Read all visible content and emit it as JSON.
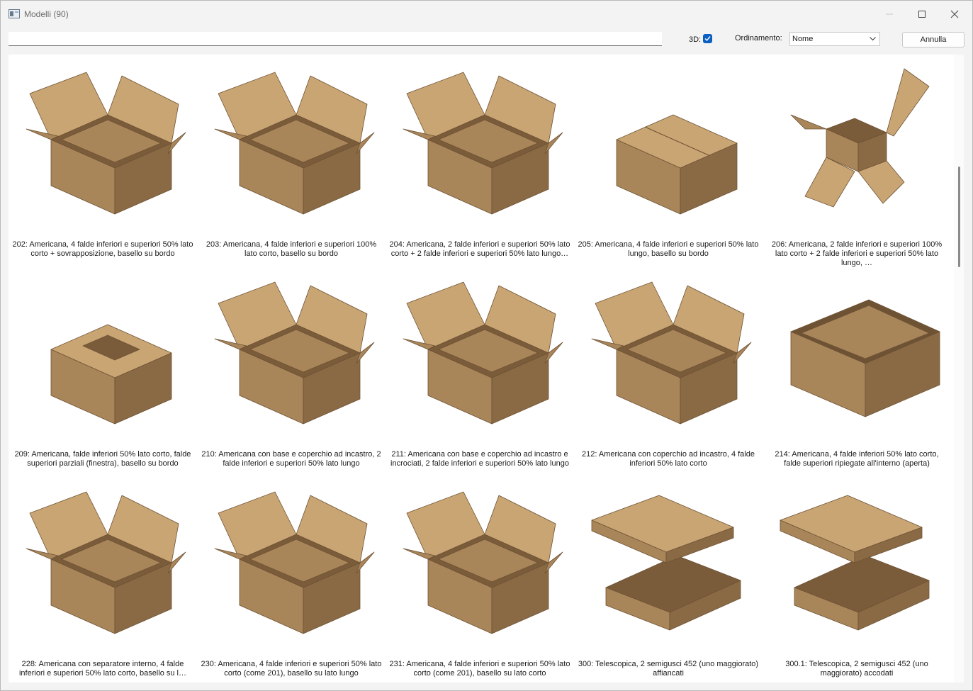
{
  "window": {
    "title": "Modelli (90)"
  },
  "toolbar": {
    "search_value": "",
    "label_3d": "3D:",
    "checkbox_3d_checked": true,
    "label_sort": "Ordinamento:",
    "sort_value": "Nome",
    "cancel_label": "Annulla"
  },
  "colors": {
    "accent": "#0a5fc2",
    "cardboard_light": "#c9a574",
    "cardboard_mid": "#a9855a",
    "cardboard_dark": "#8a6a45"
  },
  "models": [
    {
      "caption": "202: Americana, 4 falde inferiori e superiori 50% lato corto + sovrapposizione, basello su bordo",
      "icon": "box-open-4-flaps"
    },
    {
      "caption": "203: Americana, 4 falde inferiori e superiori 100% lato corto, basello su bordo",
      "icon": "box-open-long-flaps"
    },
    {
      "caption": "204: Americana, 2 falde inferiori e superiori 50% lato corto + 2 falde inferiori e superiori 50% lato lungo…",
      "icon": "box-open-4-flaps"
    },
    {
      "caption": "205: Americana, 4 falde inferiori e superiori 50% lato lungo, basello su bordo",
      "icon": "box-closed"
    },
    {
      "caption": "206: Americana, 2 falde inferiori e superiori 100% lato corto + 2 falde inferiori e superiori 50% lato lungo, …",
      "icon": "box-cross-flaps"
    },
    {
      "caption": "209: Americana, falde inferiori 50% lato corto, falde superiori parziali (finestra), basello su bordo",
      "icon": "box-window"
    },
    {
      "caption": "210: Americana con base e coperchio ad incastro, 2 falde inferiori e superiori 50% lato lungo",
      "icon": "box-interlock"
    },
    {
      "caption": "211: Americana con base e coperchio ad incastro e incrociati, 2 falde inferiori e superiori 50% lato lungo",
      "icon": "box-interlock"
    },
    {
      "caption": "212: Americana con coperchio ad incastro, 4 falde inferiori 50% lato corto",
      "icon": "box-interlock-open"
    },
    {
      "caption": "214: Americana, 4 falde inferiori 50% lato corto, falde superiori ripiegate all'interno (aperta)",
      "icon": "box-tray"
    },
    {
      "caption": "228: Americana con separatore interno, 4 falde inferiori e superiori 50% lato corto, basello su l…",
      "icon": "box-separator"
    },
    {
      "caption": "230: Americana, 4 falde inferiori e superiori 50% lato corto (come 201), basello su lato lungo",
      "icon": "box-open-4-flaps"
    },
    {
      "caption": "231: Americana, 4 falde inferiori e superiori 50% lato corto (come 201), basello su lato corto",
      "icon": "box-open-4-flaps"
    },
    {
      "caption": "300: Telescopica, 2 semigusci 452 (uno maggiorato) affiancati",
      "icon": "box-telescope"
    },
    {
      "caption": "300.1: Telescopica, 2 semigusci 452 (uno maggiorato) accodati",
      "icon": "box-telescope"
    }
  ]
}
